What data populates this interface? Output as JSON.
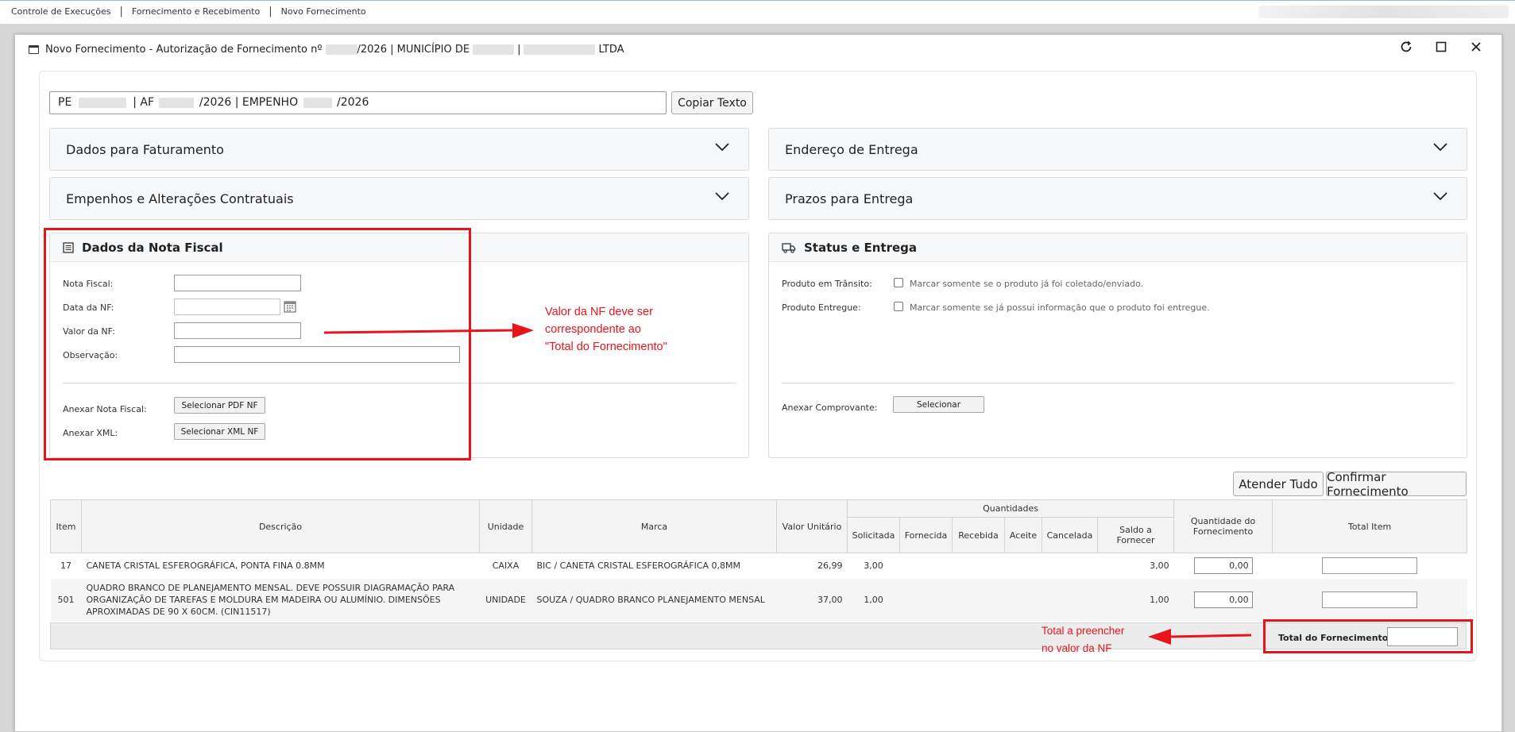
{
  "topnav": {
    "items": [
      "Controle de Execuções",
      "Fornecimento e Recebimento",
      "Novo Fornecimento"
    ]
  },
  "modal": {
    "title_part1": "Novo Fornecimento - Autorização de Fornecimento nº",
    "title_part2": "/2026 | MUNICÍPIO DE",
    "title_part3": "|",
    "title_part4": "LTDA"
  },
  "copybar": {
    "seg1": "PE",
    "seg2": "| AF",
    "seg3": "/2026 | EMPENHO",
    "seg4": "/2026",
    "button": "Copiar Texto"
  },
  "accordions": {
    "faturamento": "Dados para Faturamento",
    "endereco": "Endereço de Entrega",
    "empenhos": "Empenhos e Alterações Contratuais",
    "prazos": "Prazos para Entrega"
  },
  "nota_fiscal": {
    "heading": "Dados da Nota Fiscal",
    "nota_label": "Nota Fiscal:",
    "data_label": "Data da NF:",
    "valor_label": "Valor da NF:",
    "obs_label": "Observação:",
    "anexar_nf_label": "Anexar Nota Fiscal:",
    "anexar_nf_button": "Selecionar PDF NF",
    "anexar_xml_label": "Anexar XML:",
    "anexar_xml_button": "Selecionar XML NF"
  },
  "status": {
    "heading": "Status e Entrega",
    "transito_label": "Produto em Trânsito:",
    "transito_text": "Marcar somente se o produto já foi coletado/enviado.",
    "entregue_label": "Produto Entregue:",
    "entregue_text": "Marcar somente se já possui informação que o produto foi entregue.",
    "comprovante_label": "Anexar Comprovante:",
    "comprovante_button": "Selecionar"
  },
  "actions": {
    "atender": "Atender Tudo",
    "confirmar": "Confirmar Fornecimento"
  },
  "table": {
    "headers": {
      "item": "Item",
      "descricao": "Descrição",
      "unidade": "Unidade",
      "marca": "Marca",
      "valor_unitario": "Valor Unitário",
      "quantidades": "Quantidades",
      "solicitada": "Solicitada",
      "fornecida": "Fornecida",
      "recebida": "Recebida",
      "aceite": "Aceite",
      "cancelada": "Cancelada",
      "saldo": "Saldo a Fornecer",
      "qtd_fornecimento": "Quantidade do Fornecimento",
      "total_item": "Total Item"
    },
    "rows": [
      {
        "item": "17",
        "descricao": "CANETA CRISTAL ESFEROGRÁFICA, PONTA FINA 0.8MM",
        "unidade": "CAIXA",
        "marca": "BIC / CANETA CRISTAL ESFEROGRÁFICA 0,8MM",
        "valor_unitario": "26,99",
        "solicitada": "3,00",
        "saldo": "3,00",
        "qtd": "0,00"
      },
      {
        "item": "501",
        "descricao": "QUADRO BRANCO DE PLANEJAMENTO MENSAL. DEVE POSSUIR DIAGRAMAÇÃO PARA ORGANIZAÇÃO DE TAREFAS E MOLDURA EM MADEIRA OU ALUMÍNIO. DIMENSÕES APROXIMADAS DE 90 X 60CM. (CIN11517)",
        "unidade": "UNIDADE",
        "marca": "SOUZA / QUADRO BRANCO PLANEJAMENTO MENSAL",
        "valor_unitario": "37,00",
        "solicitada": "1,00",
        "saldo": "1,00",
        "qtd": "0,00"
      }
    ],
    "total_label": "Total do Fornecimento:"
  },
  "annotations": {
    "note1_line1": "Valor da NF deve ser",
    "note1_line2": "correspondente ao",
    "note1_line3": "\"Total do Fornecimento\"",
    "note2_line1": "Total a preencher",
    "note2_line2": "no valor da NF"
  },
  "colors": {
    "annotation_red": "#e8141c"
  }
}
